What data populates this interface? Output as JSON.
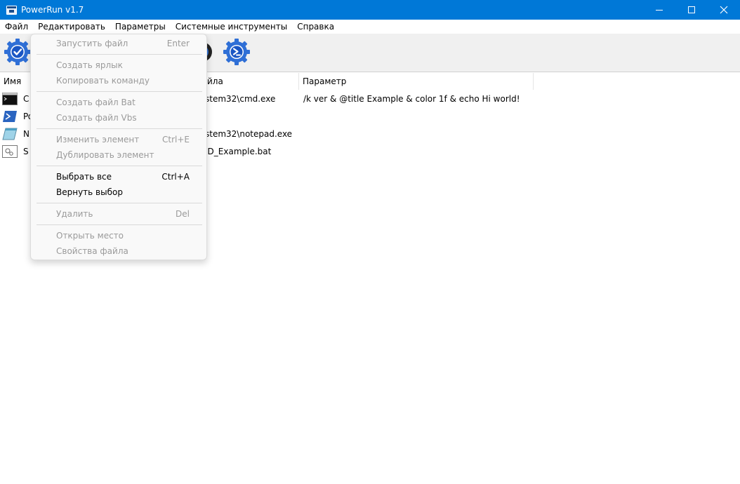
{
  "window": {
    "title": "PowerRun v1.7",
    "accent_color": "#0078d7"
  },
  "menubar": {
    "items": [
      "Файл",
      "Редактировать",
      "Параметры",
      "Системные инструменты",
      "Справка"
    ]
  },
  "toolbar": {
    "icons": [
      "check-gear-icon",
      "powershell-gear-icon"
    ]
  },
  "list": {
    "columns": [
      "Имя",
      "йла",
      "Параметр"
    ],
    "rows": [
      {
        "name": "C",
        "path": "stem32\\cmd.exe",
        "param": "/k ver & @title Example & color 1f & echo Hi world!",
        "icon": "cmd-icon"
      },
      {
        "name": "Po",
        "path": "",
        "param": "",
        "icon": "powershell-icon"
      },
      {
        "name": "N",
        "path": "stem32\\notepad.exe",
        "param": "",
        "icon": "notepad-icon"
      },
      {
        "name": "S",
        "path": "ID_Example.bat",
        "param": "",
        "icon": "bat-file-icon"
      }
    ]
  },
  "dropdown": {
    "items": [
      {
        "label": "Запустить файл",
        "shortcut": "Enter",
        "enabled": false
      },
      {
        "label": "Создать ярлык",
        "shortcut": "",
        "enabled": false
      },
      {
        "label": "Копировать команду",
        "shortcut": "",
        "enabled": false
      },
      {
        "label": "Создать файл Bat",
        "shortcut": "",
        "enabled": false
      },
      {
        "label": "Создать файл Vbs",
        "shortcut": "",
        "enabled": false
      },
      {
        "label": "Изменить элемент",
        "shortcut": "Ctrl+E",
        "enabled": false
      },
      {
        "label": "Дублировать элемент",
        "shortcut": "",
        "enabled": false
      },
      {
        "label": "Выбрать все",
        "shortcut": "Ctrl+A",
        "enabled": true
      },
      {
        "label": "Вернуть выбор",
        "shortcut": "",
        "enabled": true
      },
      {
        "label": "Удалить",
        "shortcut": "Del",
        "enabled": false
      },
      {
        "label": "Открыть место",
        "shortcut": "",
        "enabled": false
      },
      {
        "label": "Свойства файла",
        "shortcut": "",
        "enabled": false
      }
    ]
  }
}
